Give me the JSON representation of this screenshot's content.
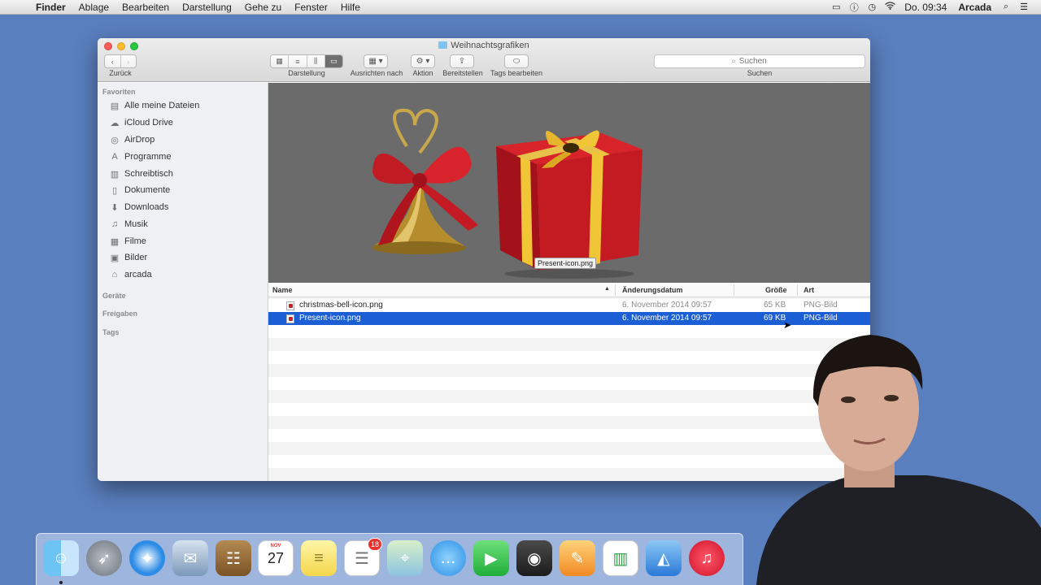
{
  "menubar": {
    "app_name": "Finder",
    "menus": [
      "Ablage",
      "Bearbeiten",
      "Darstellung",
      "Gehe zu",
      "Fenster",
      "Hilfe"
    ],
    "clock": "Do. 09:34",
    "user": "Arcada",
    "status_icons": [
      "display-mirroring-icon",
      "info-icon",
      "time-machine-icon",
      "wifi-icon"
    ]
  },
  "window": {
    "title": "Weihnachtsgrafiken",
    "toolbar": {
      "back_label": "Zurück",
      "view_label": "Darstellung",
      "arrange_label": "Ausrichten nach",
      "action_label": "Aktion",
      "share_label": "Bereitstellen",
      "tags_label": "Tags bearbeiten",
      "search_label": "Suchen",
      "search_placeholder": "Suchen"
    },
    "sidebar": {
      "favorites_heading": "Favoriten",
      "items": [
        {
          "label": "Alle meine Dateien",
          "icon": "all-files-icon"
        },
        {
          "label": "iCloud Drive",
          "icon": "cloud-icon"
        },
        {
          "label": "AirDrop",
          "icon": "airdrop-icon"
        },
        {
          "label": "Programme",
          "icon": "applications-icon"
        },
        {
          "label": "Schreibtisch",
          "icon": "desktop-icon"
        },
        {
          "label": "Dokumente",
          "icon": "documents-icon"
        },
        {
          "label": "Downloads",
          "icon": "downloads-icon"
        },
        {
          "label": "Musik",
          "icon": "music-icon"
        },
        {
          "label": "Filme",
          "icon": "movies-icon"
        },
        {
          "label": "Bilder",
          "icon": "pictures-icon"
        },
        {
          "label": "arcada",
          "icon": "home-icon"
        }
      ],
      "devices_heading": "Geräte",
      "shared_heading": "Freigaben",
      "tags_heading": "Tags"
    },
    "preview": {
      "selected_filename": "Present-icon.png"
    },
    "list": {
      "columns": {
        "name": "Name",
        "date": "Änderungsdatum",
        "size": "Größe",
        "kind": "Art"
      },
      "rows": [
        {
          "name": "christmas-bell-icon.png",
          "date": "6. November 2014 09:57",
          "size": "65 KB",
          "kind": "PNG-Bild",
          "selected": false
        },
        {
          "name": "Present-icon.png",
          "date": "6. November 2014 09:57",
          "size": "69 KB",
          "kind": "PNG-Bild",
          "selected": true
        }
      ]
    }
  },
  "dock": {
    "calendar": {
      "month": "NOV",
      "day": "27"
    },
    "reminders_badge": "18",
    "apps": [
      "finder",
      "launchpad",
      "safari",
      "mail",
      "contacts",
      "calendar",
      "notes",
      "reminders",
      "maps",
      "messages",
      "facetime",
      "photo-booth",
      "pages",
      "numbers",
      "keynote",
      "itunes"
    ]
  }
}
